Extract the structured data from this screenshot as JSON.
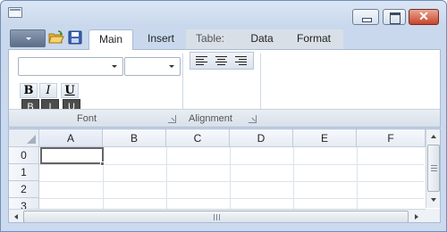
{
  "window": {
    "icon": "window-icon",
    "buttons": [
      "minimize",
      "maximize",
      "close"
    ],
    "close_glyph": "✕"
  },
  "quick_access": {
    "menu_icon": "dropdown-arrow-icon",
    "open_icon": "folder-open-icon",
    "save_icon": "save-disk-icon"
  },
  "tabs": {
    "main": "Main",
    "insert": "Insert",
    "table": "Table:",
    "data": "Data",
    "format": "Format"
  },
  "ribbon": {
    "font_group": {
      "label": "Font",
      "font_name_value": "",
      "font_size_value": "",
      "bold": "B",
      "italic": "I",
      "underline": "U",
      "bold_small": "B",
      "italic_small": "I",
      "underline_small": "U"
    },
    "alignment_group": {
      "label": "Alignment"
    }
  },
  "sheet": {
    "columns": [
      "A",
      "B",
      "C",
      "D",
      "E",
      "F"
    ],
    "rows": [
      "0",
      "1",
      "2",
      "3"
    ],
    "active_cell": "A0"
  },
  "colors": {
    "window_frame": "#c9d8ec",
    "close_button": "#c9442b",
    "ribbon_background": "#ffffff",
    "header_background": "#e6ecf4"
  }
}
